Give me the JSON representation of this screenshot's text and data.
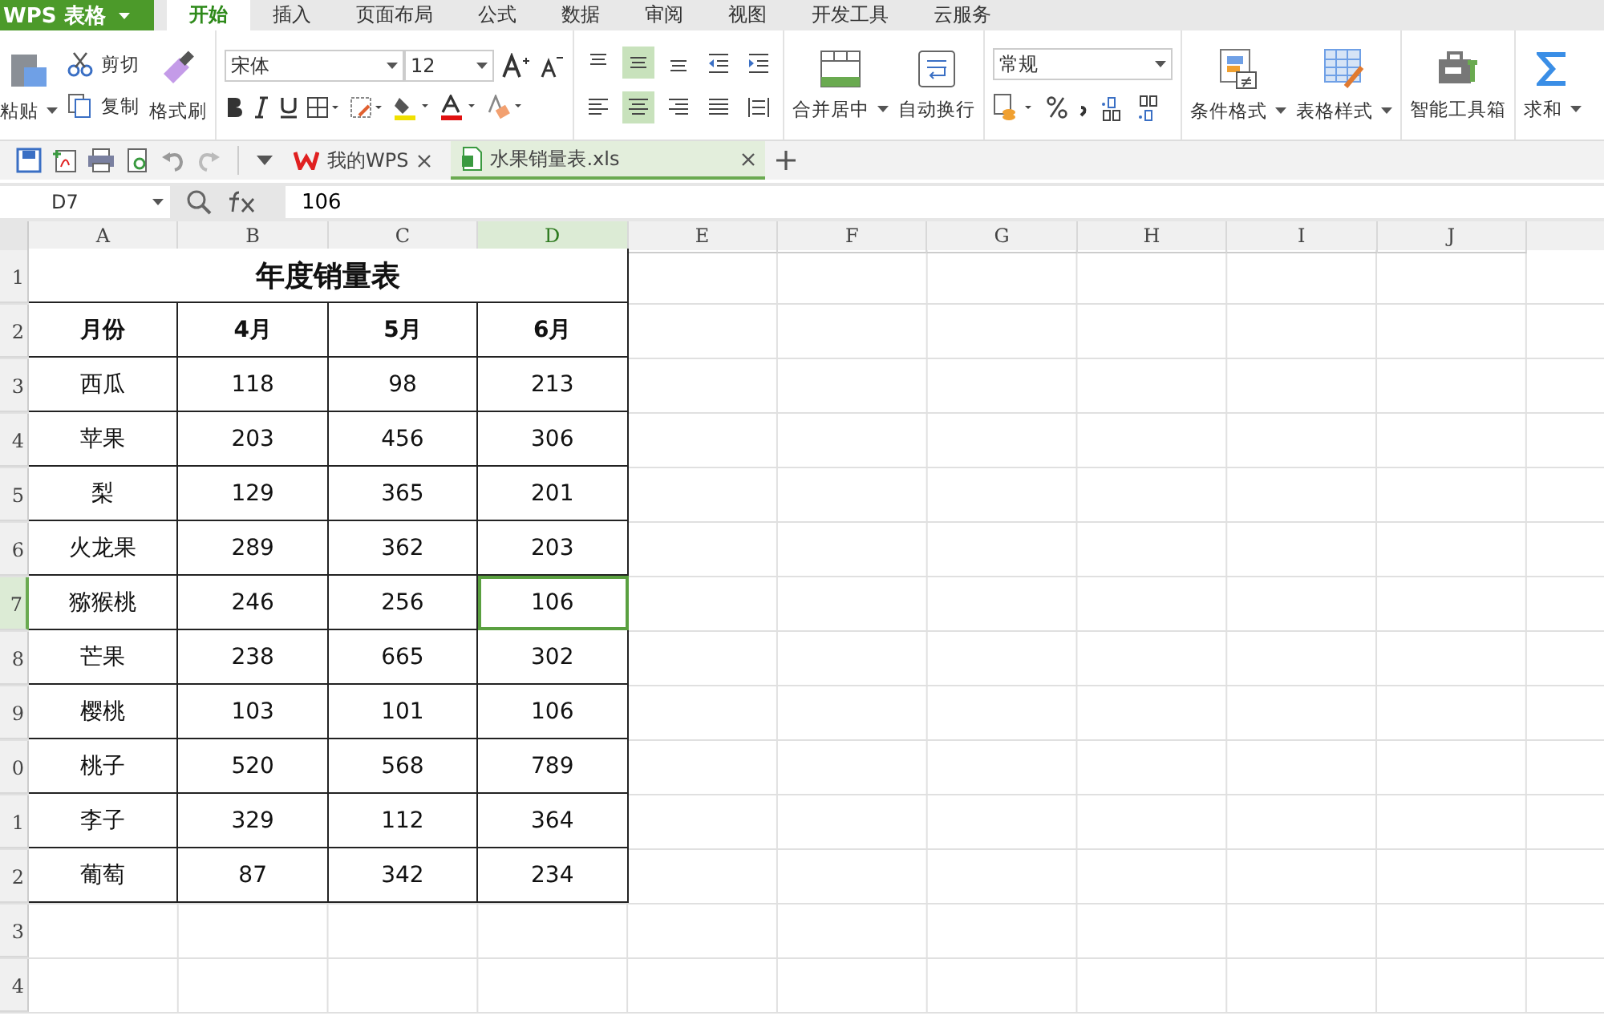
{
  "app_button": {
    "label": "WPS 表格"
  },
  "menu_tabs": [
    {
      "label": "开始",
      "selected": true
    },
    {
      "label": "插入",
      "selected": false
    },
    {
      "label": "页面布局",
      "selected": false
    },
    {
      "label": "公式",
      "selected": false
    },
    {
      "label": "数据",
      "selected": false
    },
    {
      "label": "审阅",
      "selected": false
    },
    {
      "label": "视图",
      "selected": false
    },
    {
      "label": "开发工具",
      "selected": false
    },
    {
      "label": "云服务",
      "selected": false
    }
  ],
  "ribbon": {
    "paste": "粘贴",
    "cut": "剪切",
    "copy": "复制",
    "format_painter": "格式刷",
    "font": "宋体",
    "font_size": "12",
    "merge": "合并居中",
    "wrap": "自动换行",
    "number_format": "常规",
    "conditional_format": "条件格式",
    "table_style": "表格样式",
    "toolbox": "智能工具箱",
    "sum": "求和",
    "vertical_align": [
      {
        "selected": false
      },
      {
        "selected": true
      },
      {
        "selected": false
      }
    ],
    "horizontal_align": [
      {
        "selected": false
      },
      {
        "selected": true
      },
      {
        "selected": false
      },
      {
        "selected": false
      },
      {
        "selected": false
      }
    ]
  },
  "doc_tabs": [
    {
      "label": "我的WPS",
      "selected": false
    },
    {
      "label": "水果销量表.xls",
      "selected": true
    }
  ],
  "formula_bar": {
    "name_box": "D7",
    "formula": "106"
  },
  "sheet": {
    "columns": [
      {
        "label": "A",
        "selected": false
      },
      {
        "label": "B",
        "selected": false
      },
      {
        "label": "C",
        "selected": false
      },
      {
        "label": "D",
        "selected": true
      },
      {
        "label": "E",
        "selected": false
      },
      {
        "label": "F",
        "selected": false
      },
      {
        "label": "G",
        "selected": false
      },
      {
        "label": "H",
        "selected": false
      },
      {
        "label": "I",
        "selected": false
      },
      {
        "label": "J",
        "selected": false
      }
    ],
    "rows": [
      {
        "label": "1",
        "selected": false,
        "kind": "title",
        "title": "年度销量表"
      },
      {
        "label": "2",
        "selected": false,
        "kind": "header",
        "cells": [
          "月份",
          "4月",
          "5月",
          "6月"
        ]
      },
      {
        "label": "3",
        "selected": false,
        "kind": "data",
        "cells": [
          "西瓜",
          "118",
          "98",
          "213"
        ]
      },
      {
        "label": "4",
        "selected": false,
        "kind": "data",
        "cells": [
          "苹果",
          "203",
          "456",
          "306"
        ]
      },
      {
        "label": "5",
        "selected": false,
        "kind": "data",
        "cells": [
          "梨",
          "129",
          "365",
          "201"
        ]
      },
      {
        "label": "6",
        "selected": false,
        "kind": "data",
        "cells": [
          "火龙果",
          "289",
          "362",
          "203"
        ]
      },
      {
        "label": "7",
        "selected": true,
        "kind": "data",
        "cells": [
          "猕猴桃",
          "246",
          "256",
          "106"
        ]
      },
      {
        "label": "8",
        "selected": false,
        "kind": "data",
        "cells": [
          "芒果",
          "238",
          "665",
          "302"
        ]
      },
      {
        "label": "9",
        "selected": false,
        "kind": "data",
        "cells": [
          "樱桃",
          "103",
          "101",
          "106"
        ]
      },
      {
        "label": "0",
        "selected": false,
        "kind": "data",
        "cells": [
          "桃子",
          "520",
          "568",
          "789"
        ]
      },
      {
        "label": "1",
        "selected": false,
        "kind": "data",
        "cells": [
          "李子",
          "329",
          "112",
          "364"
        ]
      },
      {
        "label": "2",
        "selected": false,
        "kind": "data",
        "cells": [
          "葡萄",
          "87",
          "342",
          "234"
        ]
      },
      {
        "label": "3",
        "selected": false,
        "kind": "empty"
      },
      {
        "label": "4",
        "selected": false,
        "kind": "empty"
      }
    ]
  }
}
